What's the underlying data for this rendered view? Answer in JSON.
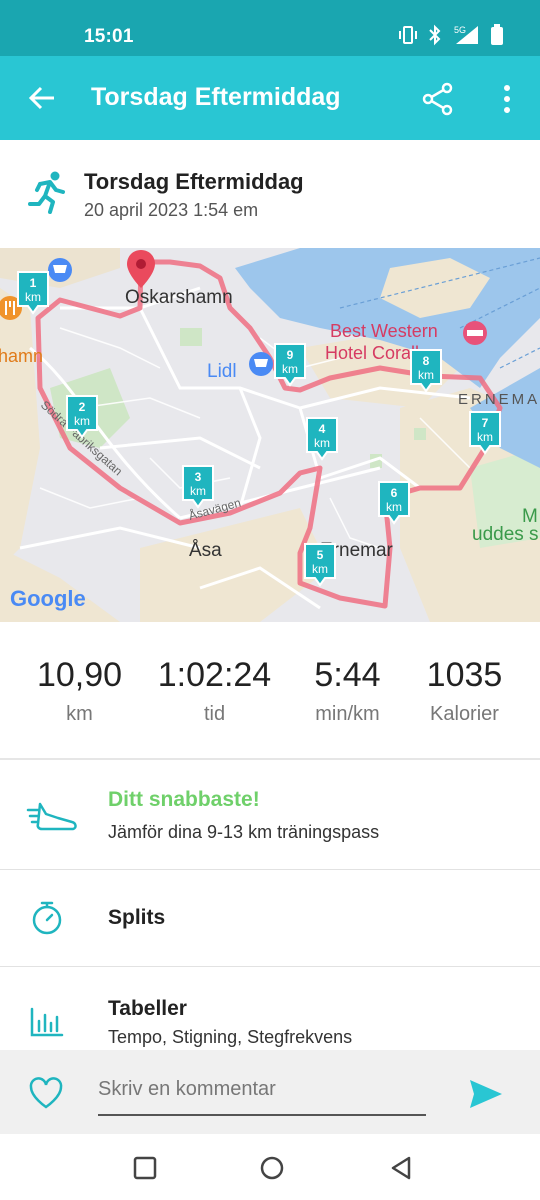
{
  "status": {
    "time": "15:01",
    "network": "5G"
  },
  "appbar": {
    "title": "Torsdag Eftermiddag"
  },
  "activity": {
    "title": "Torsdag Eftermiddag",
    "date": "20 april 2023 1:54 em"
  },
  "map": {
    "places": {
      "oskarshamn": "Oskarshamn",
      "lidl": "Lidl",
      "best_western_1": "Best Western",
      "best_western_2": "Hotel Corallen",
      "ernemar_area": "ERNEMA",
      "asa": "Åsa",
      "ernemar": "Ernemar",
      "sodra": "Södra Fabriksgatan",
      "asavagen": "Åsavägen",
      "uddes": "uddes s",
      "m": "M",
      "hamn": "hamn",
      "google": "Google"
    },
    "km_unit": "km",
    "markers": [
      "1",
      "2",
      "3",
      "4",
      "5",
      "6",
      "7",
      "8",
      "9"
    ],
    "route_color": "#ee6f82",
    "marker_color": "#1fb5bf"
  },
  "stats": [
    {
      "value": "10,90",
      "unit": "km"
    },
    {
      "value": "1:02:24",
      "unit": "tid"
    },
    {
      "value": "5:44",
      "unit": "min/km"
    },
    {
      "value": "1035",
      "unit": "Kalorier"
    }
  ],
  "achievement": {
    "title": "Ditt snabbaste!",
    "subtitle": "Jämför dina 9-13 km träningspass",
    "color": "#6fd06a"
  },
  "splits": {
    "label": "Splits"
  },
  "tables": {
    "label": "Tabeller",
    "subtitle": "Tempo, Stigning, Stegfrekvens"
  },
  "comment": {
    "placeholder": "Skriv en kommentar"
  },
  "colors": {
    "accent": "#29c6d3",
    "status": "#1aa6b0"
  }
}
